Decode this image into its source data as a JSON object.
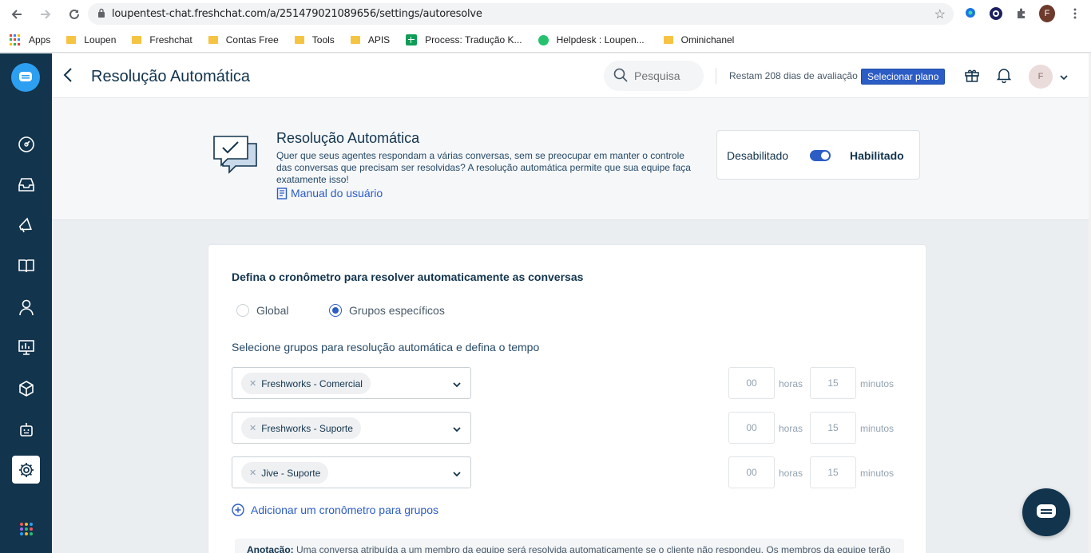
{
  "browser": {
    "url": "loupentest-chat.freshchat.com/a/251479021089656/settings/autoresolve",
    "profile_initial": "F",
    "bookmarks": [
      {
        "label": "Apps",
        "icon": "apps-grid-icon"
      },
      {
        "label": "Loupen",
        "icon": "folder-icon"
      },
      {
        "label": "Freshchat",
        "icon": "folder-icon"
      },
      {
        "label": "Contas Free",
        "icon": "folder-icon"
      },
      {
        "label": "Tools",
        "icon": "folder-icon"
      },
      {
        "label": "APIS",
        "icon": "folder-icon"
      },
      {
        "label": "Process: Tradução K...",
        "icon": "sheets-icon"
      },
      {
        "label": "Helpdesk : Loupen...",
        "icon": "freshdesk-icon"
      },
      {
        "label": "Ominichanel",
        "icon": "folder-icon"
      }
    ]
  },
  "header": {
    "title": "Resolução Automática",
    "search_placeholder": "Pesquisa",
    "trial_text": "Restam 208 dias de avaliação",
    "plan_button": "Selecionar plano",
    "avatar_initial": "F"
  },
  "intro": {
    "title": "Resolução Automática",
    "description": "Quer que seus agentes respondam a várias conversas, sem se preocupar em manter o controle das conversas que precisam ser resolvidas? A resolução automática permite que sua equipe faça exatamente isso!",
    "manual_link": "Manual do usuário",
    "toggle": {
      "off_label": "Desabilitado",
      "on_label": "Habilitado",
      "enabled": true
    }
  },
  "settings": {
    "heading": "Defina o cronômetro para resolver automaticamente as conversas",
    "radio_global": "Global",
    "radio_groups": "Grupos específicos",
    "selected": "Grupos específicos",
    "groups_label": "Selecione grupos para resolução automática e defina o tempo",
    "groups": [
      {
        "name": "Freshworks - Comercial",
        "hours": "00",
        "minutes": "15"
      },
      {
        "name": "Freshworks - Suporte",
        "hours": "00",
        "minutes": "15"
      },
      {
        "name": "Jive - Suporte",
        "hours": "00",
        "minutes": "15"
      }
    ],
    "hours_label": "horas",
    "minutes_label": "minutos",
    "add_timer": "Adicionar um cronômetro para grupos",
    "note_label": "Anotação:",
    "note_text": "Uma conversa atribuída a um membro da equipe será resolvida automaticamente se o cliente não respondeu. Os membros da equipe terão"
  },
  "colors": {
    "sidebar": "#12344d",
    "accent": "#2c5cc5",
    "logo": "#2c9ff1"
  }
}
